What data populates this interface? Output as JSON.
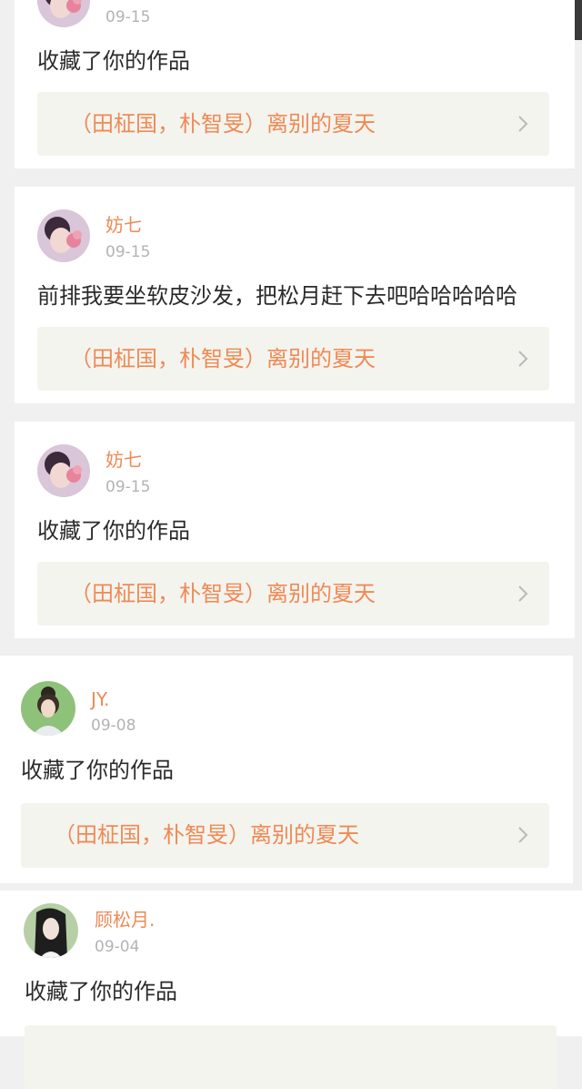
{
  "notifications": [
    {
      "username": "",
      "date": "09-15",
      "message": "收藏了你的作品",
      "work_title": "（田柾国，朴智旻）离别的夏天",
      "avatar": "girl-pink-flower-avatar"
    },
    {
      "username": "妨七",
      "date": "09-15",
      "message": "前排我要坐软皮沙发，把松月赶下去吧哈哈哈哈哈",
      "work_title": "（田柾国，朴智旻）离别的夏天",
      "avatar": "girl-pink-flower-avatar"
    },
    {
      "username": "妨七",
      "date": "09-15",
      "message": "收藏了你的作品",
      "work_title": "（田柾国，朴智旻）离别的夏天",
      "avatar": "girl-pink-flower-avatar"
    },
    {
      "username": "JY.",
      "date": "09-08",
      "message": "收藏了你的作品",
      "work_title": "（田柾国，朴智旻）离别的夏天",
      "avatar": "girl-green-background-avatar"
    },
    {
      "username": "顾松月.",
      "date": "09-04",
      "message": "收藏了你的作品",
      "work_title": "",
      "avatar": "girl-outdoor-green-avatar"
    }
  ],
  "colors": {
    "accent": "#ee8a55",
    "link_background": "#f4f4ef",
    "date_gray": "#b3b3b3",
    "text": "#2b2b2b"
  },
  "icons": {
    "chevron": "chevron-right-icon"
  }
}
